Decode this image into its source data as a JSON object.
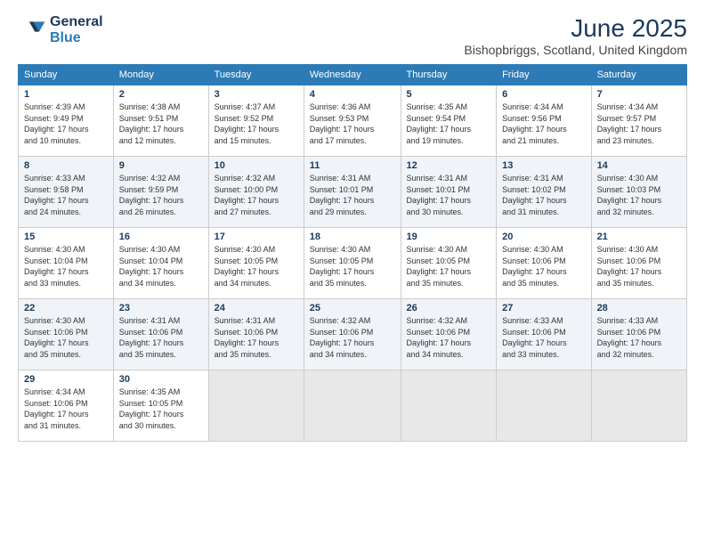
{
  "header": {
    "logo_line1": "General",
    "logo_line2": "Blue",
    "month": "June 2025",
    "location": "Bishopbriggs, Scotland, United Kingdom"
  },
  "weekdays": [
    "Sunday",
    "Monday",
    "Tuesday",
    "Wednesday",
    "Thursday",
    "Friday",
    "Saturday"
  ],
  "weeks": [
    [
      {
        "day": "1",
        "info": "Sunrise: 4:39 AM\nSunset: 9:49 PM\nDaylight: 17 hours\nand 10 minutes."
      },
      {
        "day": "2",
        "info": "Sunrise: 4:38 AM\nSunset: 9:51 PM\nDaylight: 17 hours\nand 12 minutes."
      },
      {
        "day": "3",
        "info": "Sunrise: 4:37 AM\nSunset: 9:52 PM\nDaylight: 17 hours\nand 15 minutes."
      },
      {
        "day": "4",
        "info": "Sunrise: 4:36 AM\nSunset: 9:53 PM\nDaylight: 17 hours\nand 17 minutes."
      },
      {
        "day": "5",
        "info": "Sunrise: 4:35 AM\nSunset: 9:54 PM\nDaylight: 17 hours\nand 19 minutes."
      },
      {
        "day": "6",
        "info": "Sunrise: 4:34 AM\nSunset: 9:56 PM\nDaylight: 17 hours\nand 21 minutes."
      },
      {
        "day": "7",
        "info": "Sunrise: 4:34 AM\nSunset: 9:57 PM\nDaylight: 17 hours\nand 23 minutes."
      }
    ],
    [
      {
        "day": "8",
        "info": "Sunrise: 4:33 AM\nSunset: 9:58 PM\nDaylight: 17 hours\nand 24 minutes."
      },
      {
        "day": "9",
        "info": "Sunrise: 4:32 AM\nSunset: 9:59 PM\nDaylight: 17 hours\nand 26 minutes."
      },
      {
        "day": "10",
        "info": "Sunrise: 4:32 AM\nSunset: 10:00 PM\nDaylight: 17 hours\nand 27 minutes."
      },
      {
        "day": "11",
        "info": "Sunrise: 4:31 AM\nSunset: 10:01 PM\nDaylight: 17 hours\nand 29 minutes."
      },
      {
        "day": "12",
        "info": "Sunrise: 4:31 AM\nSunset: 10:01 PM\nDaylight: 17 hours\nand 30 minutes."
      },
      {
        "day": "13",
        "info": "Sunrise: 4:31 AM\nSunset: 10:02 PM\nDaylight: 17 hours\nand 31 minutes."
      },
      {
        "day": "14",
        "info": "Sunrise: 4:30 AM\nSunset: 10:03 PM\nDaylight: 17 hours\nand 32 minutes."
      }
    ],
    [
      {
        "day": "15",
        "info": "Sunrise: 4:30 AM\nSunset: 10:04 PM\nDaylight: 17 hours\nand 33 minutes."
      },
      {
        "day": "16",
        "info": "Sunrise: 4:30 AM\nSunset: 10:04 PM\nDaylight: 17 hours\nand 34 minutes."
      },
      {
        "day": "17",
        "info": "Sunrise: 4:30 AM\nSunset: 10:05 PM\nDaylight: 17 hours\nand 34 minutes."
      },
      {
        "day": "18",
        "info": "Sunrise: 4:30 AM\nSunset: 10:05 PM\nDaylight: 17 hours\nand 35 minutes."
      },
      {
        "day": "19",
        "info": "Sunrise: 4:30 AM\nSunset: 10:05 PM\nDaylight: 17 hours\nand 35 minutes."
      },
      {
        "day": "20",
        "info": "Sunrise: 4:30 AM\nSunset: 10:06 PM\nDaylight: 17 hours\nand 35 minutes."
      },
      {
        "day": "21",
        "info": "Sunrise: 4:30 AM\nSunset: 10:06 PM\nDaylight: 17 hours\nand 35 minutes."
      }
    ],
    [
      {
        "day": "22",
        "info": "Sunrise: 4:30 AM\nSunset: 10:06 PM\nDaylight: 17 hours\nand 35 minutes."
      },
      {
        "day": "23",
        "info": "Sunrise: 4:31 AM\nSunset: 10:06 PM\nDaylight: 17 hours\nand 35 minutes."
      },
      {
        "day": "24",
        "info": "Sunrise: 4:31 AM\nSunset: 10:06 PM\nDaylight: 17 hours\nand 35 minutes."
      },
      {
        "day": "25",
        "info": "Sunrise: 4:32 AM\nSunset: 10:06 PM\nDaylight: 17 hours\nand 34 minutes."
      },
      {
        "day": "26",
        "info": "Sunrise: 4:32 AM\nSunset: 10:06 PM\nDaylight: 17 hours\nand 34 minutes."
      },
      {
        "day": "27",
        "info": "Sunrise: 4:33 AM\nSunset: 10:06 PM\nDaylight: 17 hours\nand 33 minutes."
      },
      {
        "day": "28",
        "info": "Sunrise: 4:33 AM\nSunset: 10:06 PM\nDaylight: 17 hours\nand 32 minutes."
      }
    ],
    [
      {
        "day": "29",
        "info": "Sunrise: 4:34 AM\nSunset: 10:06 PM\nDaylight: 17 hours\nand 31 minutes."
      },
      {
        "day": "30",
        "info": "Sunrise: 4:35 AM\nSunset: 10:05 PM\nDaylight: 17 hours\nand 30 minutes."
      },
      {
        "day": "",
        "info": ""
      },
      {
        "day": "",
        "info": ""
      },
      {
        "day": "",
        "info": ""
      },
      {
        "day": "",
        "info": ""
      },
      {
        "day": "",
        "info": ""
      }
    ]
  ]
}
